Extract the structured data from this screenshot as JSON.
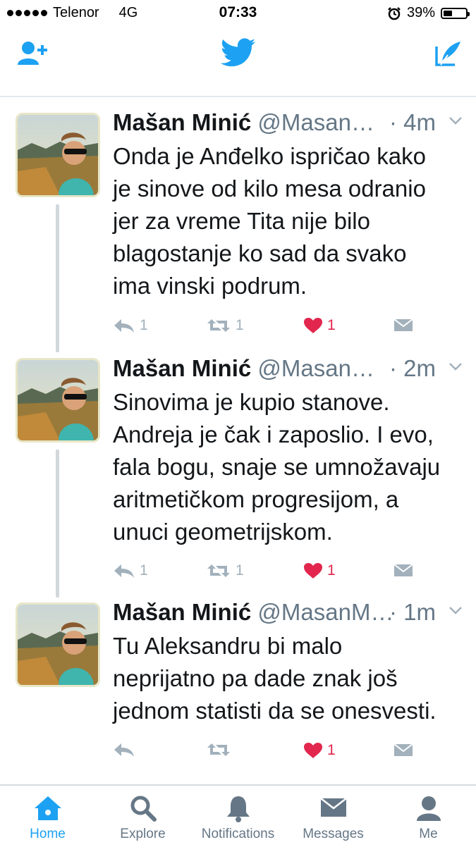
{
  "status_bar": {
    "carrier": "Telenor",
    "network": "4G",
    "time": "07:33",
    "battery": "39%",
    "battery_level": 0.39
  },
  "nav": {
    "left_icon": "add-user-icon",
    "center_icon": "twitter-bird-icon",
    "right_icon": "compose-tweet-icon"
  },
  "tweets": [
    {
      "name": "Mašan Minić",
      "handle": "@Masan…",
      "time": "· 4m",
      "text_lines": [
        "Onda je Anđelko ispričao kako",
        "je sinove od kilo mesa odranio",
        "jer za vreme Tita nije bilo",
        "blagostanje ko sad da svako",
        "ima vinski podrum."
      ],
      "replies": "1",
      "retweets": "1",
      "likes": "1"
    },
    {
      "name": "Mašan Minić",
      "handle": "@Masan…",
      "time": "· 2m",
      "text_lines": [
        "Sinovima je kupio stanove.",
        "Andreja je čak i zaposlio. I evo,",
        "fala bogu, snaje se umnožavaju",
        "aritmetičkom progresijom, a",
        "unuci geometrijskom."
      ],
      "replies": "1",
      "retweets": "1",
      "likes": "1"
    },
    {
      "name": "Mašan Minić",
      "handle": "@MasanM…",
      "time": "· 1m",
      "text_lines": [
        "Tu Aleksandru bi malo",
        "neprijatno pa dade znak još",
        "jednom statisti da se onesvesti."
      ],
      "replies": "",
      "retweets": "",
      "likes": "1"
    }
  ],
  "tabs": [
    {
      "label": "Home",
      "icon": "home-icon",
      "active": true
    },
    {
      "label": "Explore",
      "icon": "search-icon",
      "active": false
    },
    {
      "label": "Notifications",
      "icon": "bell-icon",
      "active": false
    },
    {
      "label": "Messages",
      "icon": "envelope-icon",
      "active": false
    },
    {
      "label": "Me",
      "icon": "profile-icon",
      "active": false
    }
  ],
  "colors": {
    "accent": "#1da1f2",
    "like": "#e2264d",
    "muted": "#657786",
    "icon_gray": "#a2b1bc"
  }
}
